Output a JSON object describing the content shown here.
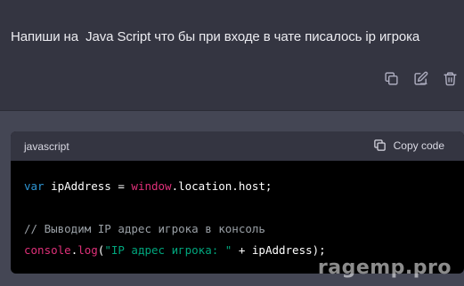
{
  "user_message": {
    "text": "Напиши на  Java Script что бы при входе в чате писалось ip игрока"
  },
  "actions": [
    {
      "name": "copy-icon"
    },
    {
      "name": "edit-icon"
    },
    {
      "name": "trash-icon"
    }
  ],
  "code_block": {
    "language": "javascript",
    "copy_label": "Copy code",
    "lines": {
      "l1_kw": "var",
      "l1_a": " ipAddress = ",
      "l1_fn": "window",
      "l1_b": ".location.host;",
      "l3_comment": "// Выводим IP адрес игрока в консоль",
      "l4_fn1": "console",
      "l4_a": ".",
      "l4_fn2": "log",
      "l4_b": "(",
      "l4_str": "\"IP адрес игрока: \"",
      "l4_c": " + ipAddress);"
    }
  },
  "watermark": "ragemp.pro",
  "colors": {
    "background": "#444654",
    "user_bg": "#343541",
    "code_bg": "#000000",
    "keyword": "#2e95d3",
    "function": "#df3079",
    "string": "#00a67d",
    "comment": "#9aa0a6"
  }
}
